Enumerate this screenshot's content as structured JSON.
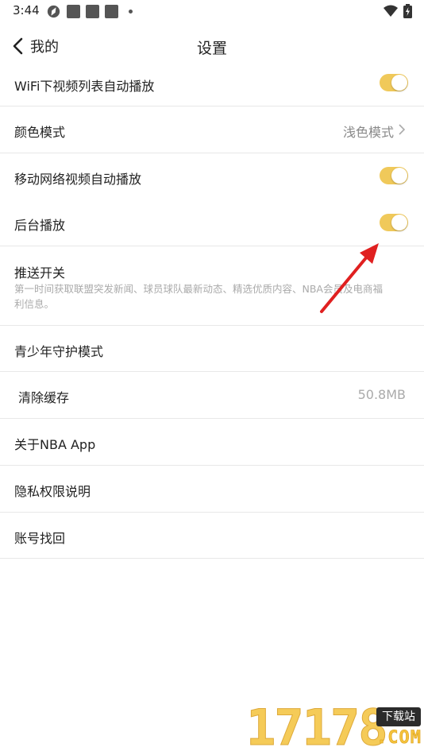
{
  "status_bar": {
    "time": "3:44",
    "icons": [
      "sync-icon",
      "notification-square-icon",
      "notification-square-icon",
      "notification-square-icon",
      "more-dot-icon",
      "wifi-icon",
      "battery-charging-icon"
    ]
  },
  "header": {
    "back_label": "我的",
    "title": "设置"
  },
  "settings": {
    "wifi_autoplay": {
      "label": "WiFi下视频列表自动播放",
      "enabled": true
    },
    "color_mode": {
      "label": "颜色模式",
      "value": "浅色模式"
    },
    "mobile_autoplay": {
      "label": "移动网络视频自动播放",
      "enabled": true
    },
    "background_play": {
      "label": "后台播放",
      "enabled": true
    },
    "push": {
      "label": "推送开关",
      "description": "第一时间获取联盟突发新闻、球员球队最新动态、精选优质内容、NBA会员及电商福利信息。"
    },
    "youth_mode": {
      "label": "青少年守护模式"
    },
    "clear_cache": {
      "label": "清除缓存",
      "value": "50.8MB"
    },
    "about": {
      "label": "关于NBA App"
    },
    "privacy": {
      "label": "隐私权限说明"
    },
    "account_recovery": {
      "label": "账号找回"
    }
  },
  "colors": {
    "toggle_on": "#f0c95a",
    "annotation_arrow": "#e02020"
  },
  "watermark": {
    "number": "17178",
    "tag": "下载站",
    "suffix": ".COM"
  }
}
